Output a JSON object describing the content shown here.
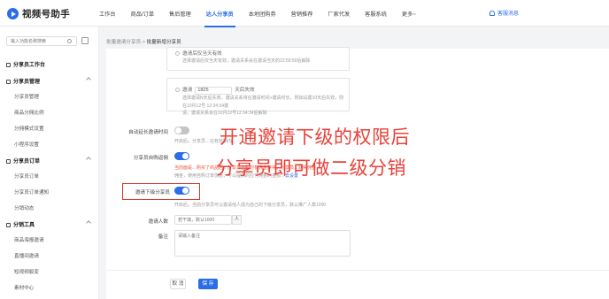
{
  "app": {
    "name": "视频号助手"
  },
  "topnav": [
    "工作台",
    "商品/订单",
    "售后管理",
    "达人分享员",
    "本地团购券",
    "营销推荐",
    "厂家代发",
    "客服系统",
    "更多~"
  ],
  "notify_label": "客服消息",
  "sidebar": {
    "search_placeholder": "输入功能名称搜索",
    "items": [
      {
        "label": "分享员工作台",
        "type": "group"
      },
      {
        "label": "分享员管理",
        "type": "group"
      },
      {
        "label": "分享员管理",
        "type": "sub"
      },
      {
        "label": "商品分佣比例",
        "type": "sub"
      },
      {
        "label": "分佣模式设置",
        "type": "sub"
      },
      {
        "label": "小程序设置",
        "type": "sub"
      },
      {
        "label": "分享员订单",
        "type": "group"
      },
      {
        "label": "分享员订单",
        "type": "sub"
      },
      {
        "label": "分享员订单通知",
        "type": "sub"
      },
      {
        "label": "分销动态",
        "type": "sub"
      },
      {
        "label": "分销工具",
        "type": "group"
      },
      {
        "label": "商品海报邀请",
        "type": "sub"
      },
      {
        "label": "直播间邀请",
        "type": "sub"
      },
      {
        "label": "短视频裂变",
        "type": "sub"
      },
      {
        "label": "素材中心",
        "type": "sub"
      }
    ]
  },
  "breadcrumb": {
    "parent": "批量邀请分享员",
    "separator": ">",
    "current": "批量新增分享员"
  },
  "binding": {
    "opt1_label": "邀请后仅当天有效",
    "opt1_desc": "选择邀请后仅当天有效，邀请关系会在邀请当天的23:59:59后解除",
    "opt2_prefix": "邀请",
    "opt2_value": "1825",
    "opt2_suffix": "天后失效",
    "opt2_desc_line1": "选择邀请N天后失效，邀请关系将在邀请时间+邀请时长，例如设置10天后失效，则在10月12号 12:34:34邀",
    "opt2_desc_line2": "请，邀请关系会在10月22号12:34:34后解除"
  },
  "rows": {
    "auto_extend_label": "自动延长邀请时间",
    "auto_extend_hint": "开启后，分享员…在有效期内…",
    "self_buy_label": "分享员自购返佣",
    "self_buy_hint1": "当前面是…购买了商品后…分享员自购时有佣金获得，分享员…获得佣金",
    "self_buy_hint2": "佣金，使用自购订单优惠，可以提高的应付佣金的金额…",
    "self_buy_link": "去设置",
    "invite_label": "邀请下级分享员",
    "invite_hint": "开启后，当前分享员可以邀请他人成为自己的下级分享员，默认推广人数1000",
    "invite_count_label": "邀请人数",
    "invite_count_placeholder": "若干填，默认1000",
    "invite_count_unit": "人",
    "remark_label": "备注",
    "remark_placeholder": "请输入备注"
  },
  "overlay": {
    "line1": "开通邀请下级的权限后",
    "line2": "分享员即可做二级分销"
  },
  "footer": {
    "cancel": "取 消",
    "save": "保 存"
  },
  "toggles": {
    "auto_extend": false,
    "self_buy": true,
    "invite": true
  },
  "colors": {
    "accent": "#2b6de8",
    "overlay": "#e7423a",
    "highlight": "#d7392a"
  }
}
